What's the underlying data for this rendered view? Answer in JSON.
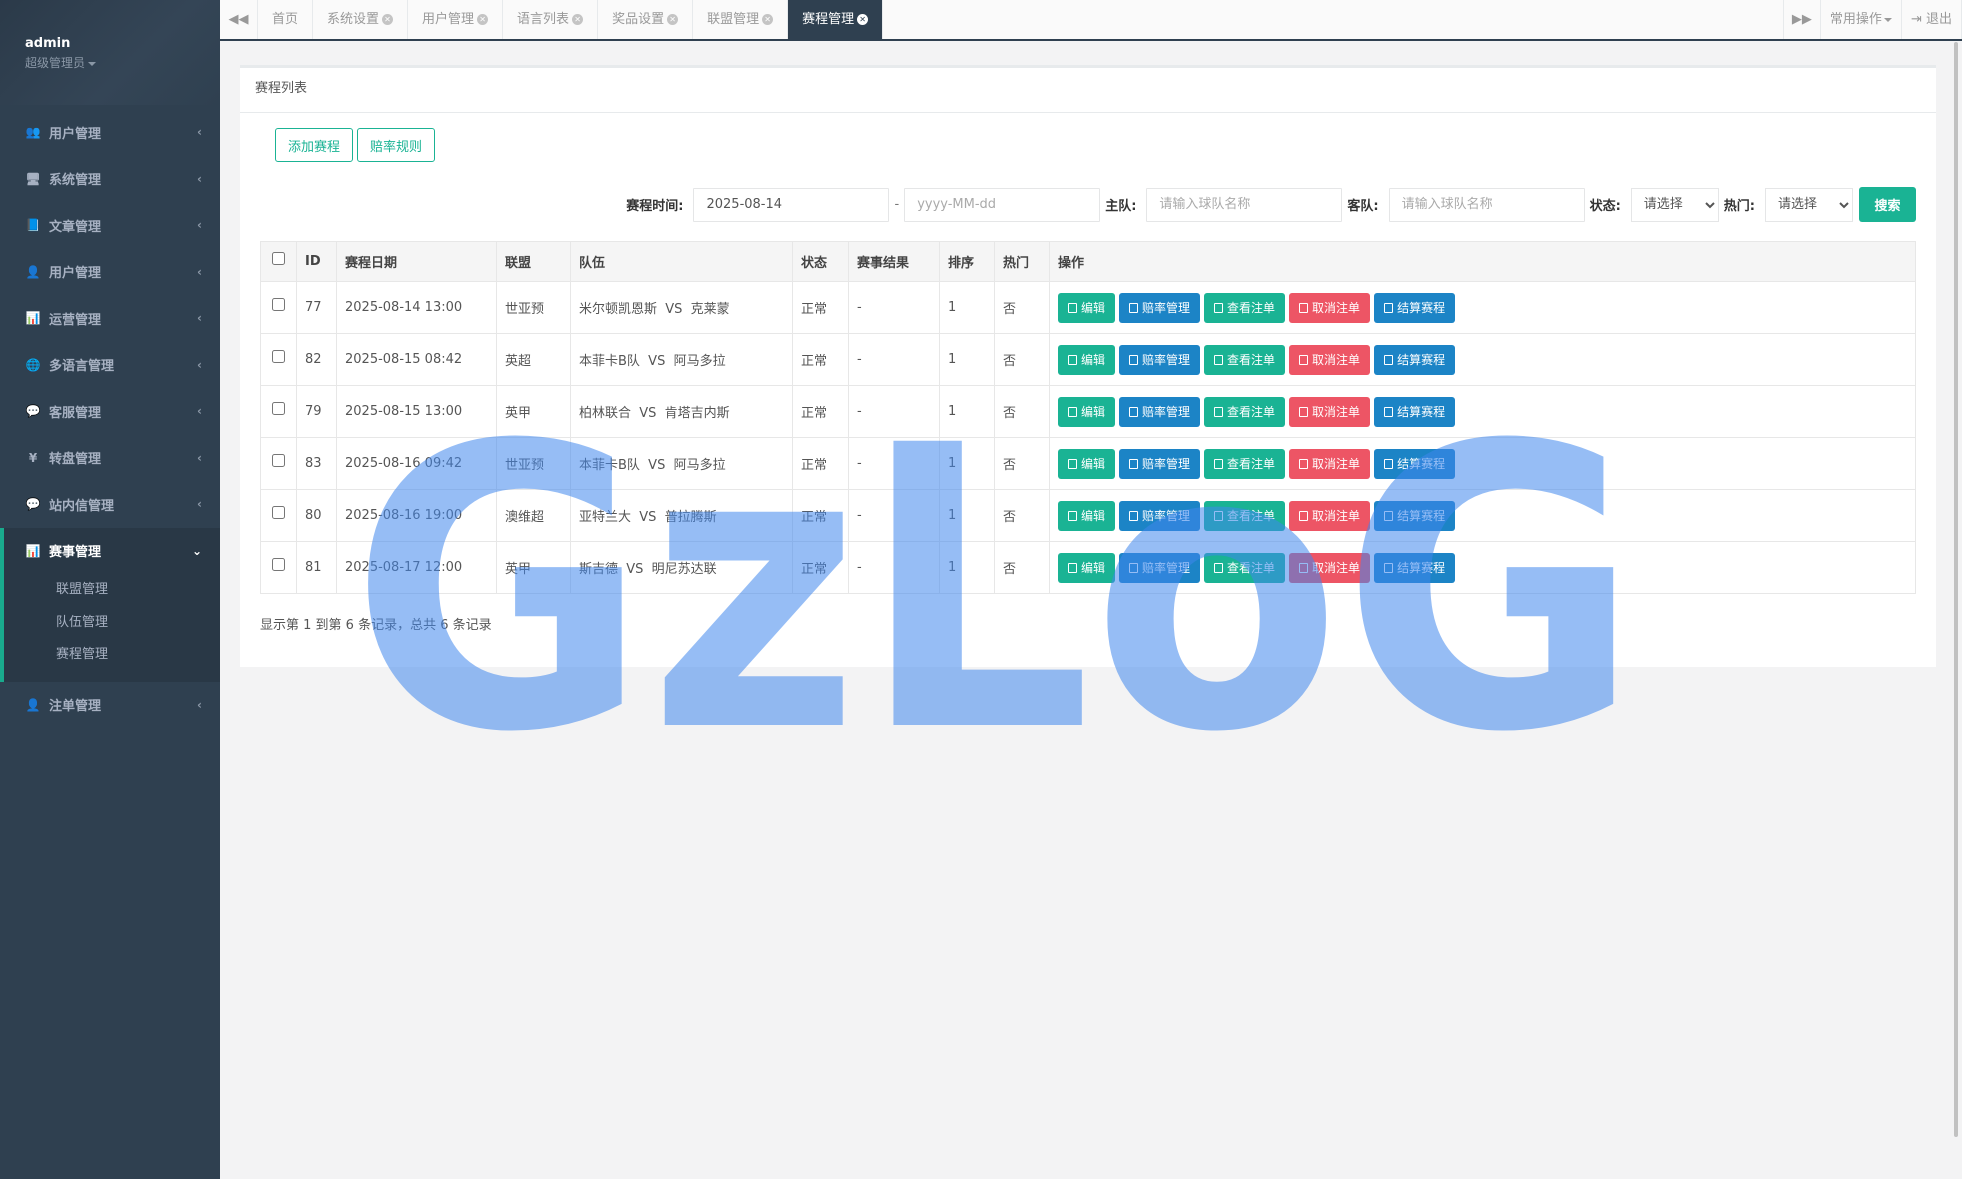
{
  "user": {
    "name": "admin",
    "role": "超级管理员"
  },
  "sidebar": {
    "items": [
      {
        "label": "用户管理",
        "icon": "users-icon",
        "glyph": "👥"
      },
      {
        "label": "系统管理",
        "icon": "desktop-icon",
        "glyph": "🖥"
      },
      {
        "label": "文章管理",
        "icon": "book-icon",
        "glyph": "📘"
      },
      {
        "label": "用户管理",
        "icon": "user-icon",
        "glyph": "👤"
      },
      {
        "label": "运营管理",
        "icon": "chart-icon",
        "glyph": "📊"
      },
      {
        "label": "多语言管理",
        "icon": "globe-icon",
        "glyph": "🌐"
      },
      {
        "label": "客服管理",
        "icon": "chat-icon",
        "glyph": "💬"
      },
      {
        "label": "转盘管理",
        "icon": "yen-icon",
        "glyph": "¥"
      },
      {
        "label": "站内信管理",
        "icon": "chat-icon",
        "glyph": "💬"
      }
    ],
    "active": {
      "label": "赛事管理",
      "icon": "chart-icon",
      "glyph": "📊",
      "children": [
        "联盟管理",
        "队伍管理",
        "赛程管理"
      ]
    },
    "after": [
      {
        "label": "注单管理",
        "icon": "user-icon",
        "glyph": "👤"
      }
    ]
  },
  "topbar": {
    "tabs": [
      {
        "label": "首页",
        "closable": false
      },
      {
        "label": "系统设置",
        "closable": true
      },
      {
        "label": "用户管理",
        "closable": true
      },
      {
        "label": "语言列表",
        "closable": true
      },
      {
        "label": "奖品设置",
        "closable": true
      },
      {
        "label": "联盟管理",
        "closable": true
      },
      {
        "label": "赛程管理",
        "closable": true,
        "active": true
      }
    ],
    "common_ops": "常用操作",
    "logout": "退出"
  },
  "panel": {
    "title": "赛程列表",
    "add_button": "添加赛程",
    "odds_rules_button": "赔率规则"
  },
  "search": {
    "time_label": "赛程时间:",
    "start_date": "2025-08-14",
    "end_placeholder": "yyyy-MM-dd",
    "home_label": "主队:",
    "home_placeholder": "请输入球队名称",
    "away_label": "客队:",
    "away_placeholder": "请输入球队名称",
    "status_label": "状态:",
    "status_value": "请选择",
    "hot_label": "热门:",
    "hot_value": "请选择",
    "submit": "搜索"
  },
  "table": {
    "headers": [
      "ID",
      "赛程日期",
      "联盟",
      "队伍",
      "状态",
      "赛事结果",
      "排序",
      "热门",
      "操作"
    ],
    "ops": [
      "编辑",
      "赔率管理",
      "查看注单",
      "取消注单",
      "结算赛程"
    ],
    "rows": [
      {
        "id": "77",
        "date": "2025-08-14 13:00",
        "league": "世亚预",
        "teams": "米尔顿凯恩斯  VS  克莱蒙",
        "status": "正常",
        "result": "-",
        "sort": "1",
        "hot": "否"
      },
      {
        "id": "82",
        "date": "2025-08-15 08:42",
        "league": "英超",
        "teams": "本菲卡B队  VS  阿马多拉",
        "status": "正常",
        "result": "-",
        "sort": "1",
        "hot": "否"
      },
      {
        "id": "79",
        "date": "2025-08-15 13:00",
        "league": "英甲",
        "teams": "柏林联合  VS  肯塔吉内斯",
        "status": "正常",
        "result": "-",
        "sort": "1",
        "hot": "否"
      },
      {
        "id": "83",
        "date": "2025-08-16 09:42",
        "league": "世亚预",
        "teams": "本菲卡B队  VS  阿马多拉",
        "status": "正常",
        "result": "-",
        "sort": "1",
        "hot": "否"
      },
      {
        "id": "80",
        "date": "2025-08-16 19:00",
        "league": "澳维超",
        "teams": "亚特兰大  VS  普拉腾斯",
        "status": "正常",
        "result": "-",
        "sort": "1",
        "hot": "否"
      },
      {
        "id": "81",
        "date": "2025-08-17 12:00",
        "league": "英甲",
        "teams": "斯吉德  VS  明尼苏达联",
        "status": "正常",
        "result": "-",
        "sort": "1",
        "hot": "否"
      }
    ]
  },
  "footer": {
    "pagination_text": "显示第 1 到第 6 条记录，总共 6 条记录"
  },
  "watermark": {
    "text": "GzLoG",
    "color": "#3f86ec"
  },
  "colors": {
    "sidebar": "#2f4050",
    "primary": "#1ab394",
    "info": "#1c84c6",
    "danger": "#ed5565"
  }
}
